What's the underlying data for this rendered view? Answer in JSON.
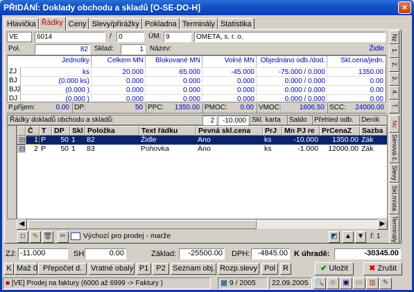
{
  "window": {
    "title": "PŘIDÁNÍ: Doklady obchodu a skladů [O-SE-DO-H]",
    "close": "×"
  },
  "tabs": [
    "Hlavička",
    "Řádky",
    "Ceny",
    "Slevy/přirážky",
    "Pokladna",
    "Terminály",
    "Statistika"
  ],
  "header": {
    "ve_label": "VE",
    "ve_value": "6014",
    "slash": "/",
    "num": "0",
    "um_label": "ÚM:",
    "um_value": "9",
    "company": "OMETA, s. r. o."
  },
  "pol_row": {
    "pol_label": "Pol.",
    "pol_value": "82",
    "sklad_label": "Sklad:",
    "sklad_value": "1",
    "nazev_label": "Název:",
    "nazev_value": "Židle"
  },
  "qty_table": {
    "headers": [
      "Jednotky",
      "Celkem MN",
      "Blokované MN",
      "Volné MN",
      "Objednáno odb./dod.",
      "Skl.cena/jedn."
    ],
    "rows": [
      {
        "label": "ZJ",
        "cells": [
          "ks",
          "20.000",
          "65.000",
          "-45.000",
          "-75.000 / 0.000",
          "1350.00"
        ]
      },
      {
        "label": "BJ",
        "cells": [
          "(0.000 ks)",
          "0.000",
          "0.000",
          "0.000",
          "0.000 / 0.000",
          "0.00"
        ]
      },
      {
        "label": "BJ2",
        "cells": [
          "(0.000 )",
          "0.000",
          "0.000",
          "0.000",
          "0.000 / 0.000",
          "0.00"
        ]
      },
      {
        "label": "DJ",
        "cells": [
          "(0.000 )",
          "0.000",
          "0.000",
          "0.000",
          "0.000 / 0.000",
          "0.00"
        ]
      }
    ]
  },
  "prijem_row": {
    "p_label": "P.příjem:",
    "p_value": "0.00",
    "dp_label": "DP:",
    "dp_value": "50",
    "ppc_label": "PPC:",
    "ppc_value": "1350.00",
    "pmoc_label": "PMOC:",
    "pmoc_value": "0.00",
    "vmoc_label": "VMOC:",
    "vmoc_value": "1606.50",
    "scc_label": "SCC:",
    "scc_value": "24000.00"
  },
  "lines_bar": {
    "title": "Řádky dokladů obchodu a skladů:",
    "count": "2",
    "sum": "-10.000",
    "btn1": "Skl. karta",
    "btn2": "Saldo",
    "btn3": "Přehled odb.",
    "btn4": "Deník"
  },
  "grid": {
    "columns": [
      "Č",
      "T",
      "DP",
      "Skl",
      "Položka",
      "Text řádku",
      "Pevná skl.cena",
      "PrJ",
      "Mn PJ re",
      "PrCenaZ",
      "Sazba"
    ],
    "rows": [
      {
        "c": "1",
        "t": "P",
        "dp": "50",
        "skl": "1",
        "polozka": "82",
        "text": "Židle",
        "pevna": "Ano",
        "prj": "ks",
        "mn": "-10.000",
        "cena": "1350.00",
        "sazba": "Zák"
      },
      {
        "c": "2",
        "t": "P",
        "dp": "50",
        "skl": "1",
        "polozka": "83",
        "text": "Pohovka",
        "pevna": "Ano",
        "prj": "ks",
        "mn": "-1.000",
        "cena": "12000.00",
        "sazba": "Zák"
      }
    ]
  },
  "vtabs": [
    "Nz",
    "1.",
    "2.",
    "3.",
    "4.",
    "T.",
    "Nc",
    "Sériová č.",
    "Slevy",
    "Skl.místa",
    "Terminály"
  ],
  "grid_toolbar": {
    "default_label": "Výchozí pro prodej - marže",
    "page": "ř: 1"
  },
  "totals": {
    "zj_label": "ZJ:",
    "zj_value": "-11.000",
    "sh_label": "SH:",
    "sh_value": "0.00",
    "zaklad_label": "Základ:",
    "zaklad_value": "-25500.00",
    "dph_label": "DPH:",
    "dph_value": "-4845.00",
    "uhrade_label": "K úhradě:",
    "uhrade_value": "-30345.00"
  },
  "bottom_buttons": [
    "K",
    "Maž 0",
    "Přepočet d.",
    "Vratné obaly",
    "P1",
    "P2",
    "Seznam obj.",
    "Rozp.slevy",
    "Pol",
    "R"
  ],
  "ulozit": "Uložit",
  "zrusit": "Zrušit",
  "status": {
    "text": "[VE] Prodej na faktury (6000 až 6999 -> Faktury )",
    "period": "9 / 2005",
    "date": "22.09.2005"
  },
  "colors": {
    "title": "#0b3aa8",
    "accent_red": "#c00000",
    "blue_text": "#0000c8",
    "selected_row": "#0a246a"
  }
}
